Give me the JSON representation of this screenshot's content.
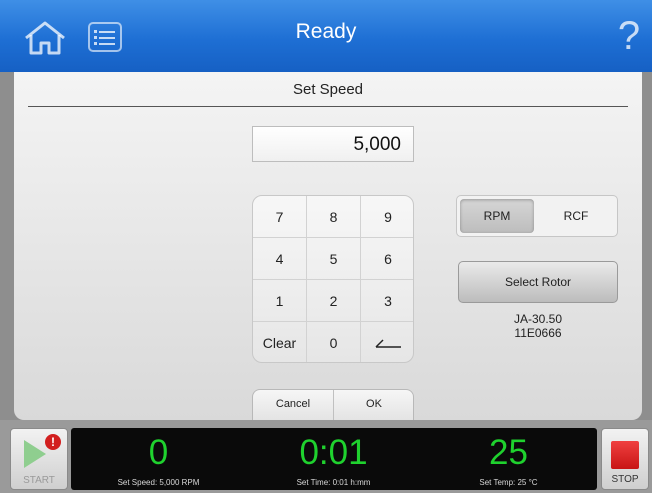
{
  "header": {
    "title": "Ready",
    "help_glyph": "?",
    "home_icon": "home-icon",
    "menu_icon": "list-menu-icon"
  },
  "panel": {
    "title": "Set Speed",
    "value": "5,000",
    "keypad": {
      "keys": [
        "7",
        "8",
        "9",
        "4",
        "5",
        "6",
        "1",
        "2",
        "3",
        "Clear",
        "0",
        ""
      ],
      "backspace_icon": "backspace-arrow-icon"
    },
    "units": {
      "active": "RPM",
      "inactive": "RCF"
    },
    "select_rotor_label": "Select Rotor",
    "rotor": {
      "name": "JA-30.50",
      "serial": "11E0666"
    },
    "cancel_label": "Cancel",
    "ok_label": "OK"
  },
  "status": {
    "start_label": "START",
    "start_alert": "!",
    "speed": {
      "value": "0",
      "label": "Set Speed: 5,000 RPM"
    },
    "time": {
      "value": "0:01",
      "label": "Set Time: 0:01 h:mm"
    },
    "temp": {
      "value": "25",
      "label": "Set Temp: 25 °C"
    },
    "stop_label": "STOP"
  },
  "colors": {
    "accent_blue": "#1e6fd4",
    "readout_green": "#1fd12e",
    "stop_red": "#d21f1f"
  }
}
